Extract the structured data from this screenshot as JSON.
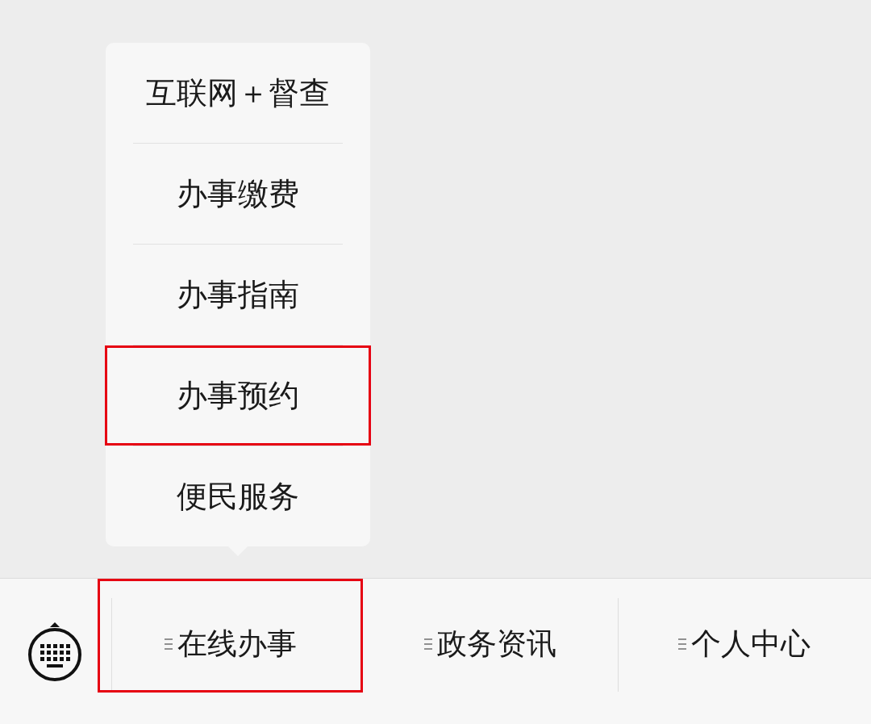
{
  "submenu": {
    "items": [
      {
        "label": "互联网＋督查",
        "highlighted": false
      },
      {
        "label": "办事缴费",
        "highlighted": false
      },
      {
        "label": "办事指南",
        "highlighted": false
      },
      {
        "label": "办事预约",
        "highlighted": true
      },
      {
        "label": "便民服务",
        "highlighted": false
      }
    ]
  },
  "menu_bar": {
    "tabs": [
      {
        "label": "在线办事",
        "highlighted": true
      },
      {
        "label": "政务资讯",
        "highlighted": false
      },
      {
        "label": "个人中心",
        "highlighted": false
      }
    ]
  }
}
